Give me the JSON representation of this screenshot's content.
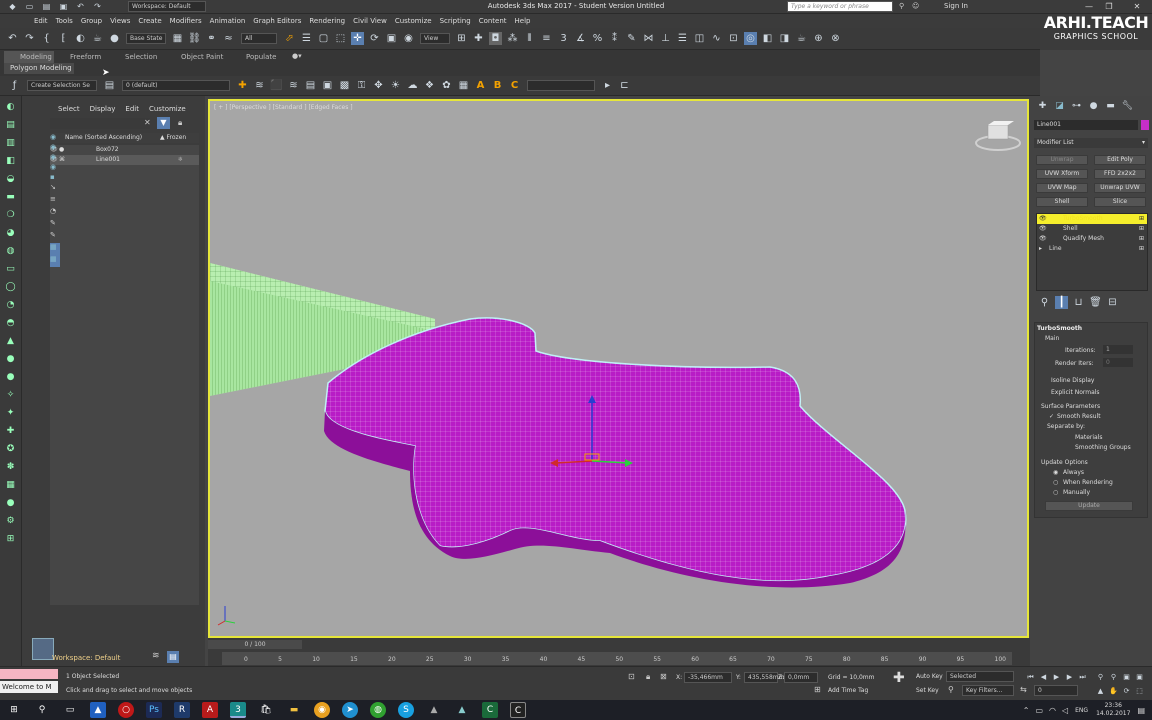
{
  "app": {
    "title": "Autodesk 3ds Max 2017 - Student Version   Untitled",
    "workspace": "Workspace: Default",
    "search_placeholder": "Type a keyword or phrase",
    "sign_in": "Sign In"
  },
  "brand": {
    "line1": "ARHI.TEACH",
    "line2": "GRAPHICS SCHOOL"
  },
  "menu": [
    "Edit",
    "Tools",
    "Group",
    "Views",
    "Create",
    "Modifiers",
    "Animation",
    "Graph Editors",
    "Rendering",
    "Civil View",
    "Customize",
    "Scripting",
    "Content",
    "Help"
  ],
  "toolbar": {
    "base_state": "Base State",
    "selection_filter": "All",
    "view": "View",
    "create_selection_set": "Create Selection Se",
    "layer": "0 (default)"
  },
  "ribbon": {
    "tabs": [
      "Modeling",
      "Freeform",
      "Selection",
      "Object Paint",
      "Populate"
    ],
    "subtitle": "Polygon Modeling"
  },
  "scene_explorer": {
    "menu": [
      "Select",
      "Display",
      "Edit",
      "Customize"
    ],
    "column_name": "Name (Sorted Ascending)",
    "column_frozen": "▲ Frozen",
    "items": [
      "Box072",
      "Line001"
    ],
    "workspace": "Workspace: Default"
  },
  "viewport": {
    "label": "[ + ] [Perspective ] [Standard ] [Edged Faces ]"
  },
  "command_panel": {
    "object_name": "Line001",
    "modifier_list": "Modifier List",
    "buttons": [
      "Unwrap",
      "Edit Poly",
      "UVW Xform",
      "FFD 2x2x2",
      "UVW Map",
      "Unwrap UVW",
      "Shell",
      "Slice"
    ],
    "stack": [
      "TurboSmooth",
      "Shell",
      "Quadify Mesh",
      "Line"
    ],
    "rollout_title": "TurboSmooth",
    "main": "Main",
    "iterations_label": "Iterations:",
    "iterations_value": "1",
    "render_iters_label": "Render Iters:",
    "render_iters_value": "0",
    "isoline": "Isoline Display",
    "explicit_normals": "Explicit Normals",
    "surface_params": "Surface Parameters",
    "smooth_result": "Smooth Result",
    "separate_by": "Separate by:",
    "materials": "Materials",
    "smoothing_groups": "Smoothing Groups",
    "update_options": "Update Options",
    "always": "Always",
    "when_rendering": "When Rendering",
    "manually": "Manually",
    "update_button": "Update"
  },
  "timeline": {
    "frame": "0 / 100",
    "ticks": [
      "0",
      "5",
      "10",
      "15",
      "20",
      "25",
      "30",
      "35",
      "40",
      "45",
      "50",
      "55",
      "60",
      "65",
      "70",
      "75",
      "80",
      "85",
      "90",
      "95",
      "100"
    ]
  },
  "status": {
    "listener": "Welcome to M",
    "objects_selected": "1 Object Selected",
    "hint": "Click and drag to select and move objects",
    "x_label": "X:",
    "x_value": "-35,466mm",
    "y_label": "Y:",
    "y_value": "435,558mm",
    "z_label": "Z:",
    "z_value": "0,0mm",
    "grid": "Grid = 10,0mm",
    "add_time_tag": "Add Time Tag",
    "auto_key": "Auto Key",
    "selected": "Selected",
    "set_key": "Set Key",
    "key_filters": "Key Filters...",
    "frame_value": "0"
  },
  "taskbar": {
    "lang": "ENG",
    "time": "23:36",
    "date": "14.02.2017"
  }
}
